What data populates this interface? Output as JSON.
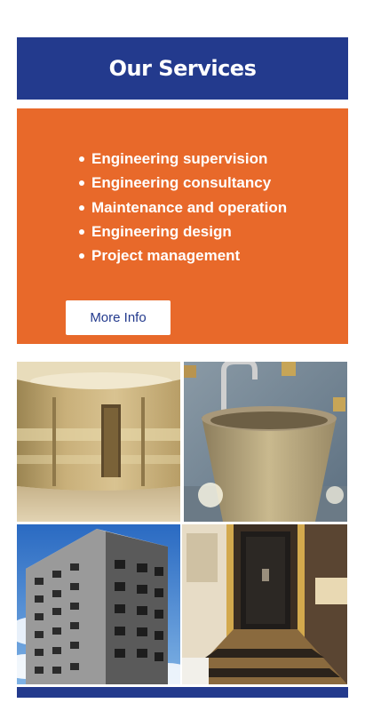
{
  "header": {
    "title": "Our Services"
  },
  "services": {
    "items": [
      "Engineering supervision",
      "Engineering consultancy",
      "Maintenance and operation",
      "Engineering design",
      "Project management"
    ],
    "button_label": "More Info"
  },
  "gallery": {
    "images": [
      "curved-wooden-room-photo",
      "stone-basin-photo",
      "apartment-building-photo",
      "hotel-corridor-photo"
    ]
  },
  "colors": {
    "brand_blue": "#233a8d",
    "accent_orange": "#e8692a"
  }
}
